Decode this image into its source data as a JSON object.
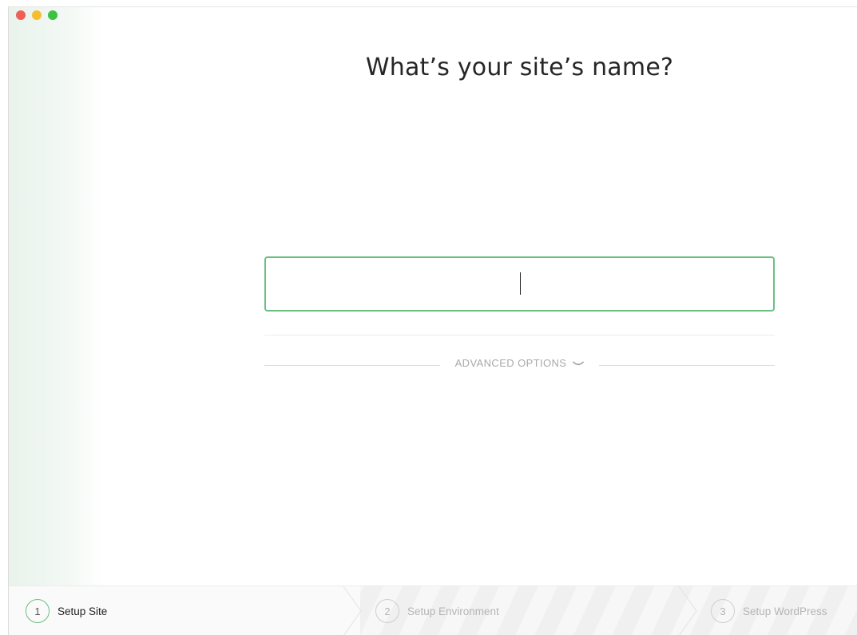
{
  "window": {
    "controls": [
      "close",
      "minimize",
      "maximize"
    ]
  },
  "main": {
    "title": "What’s your site’s name?",
    "site_name_input": {
      "value": "",
      "placeholder": ""
    },
    "advanced_options_label": "ADVANCED OPTIONS",
    "advanced_options_icon": "chevron-down-icon"
  },
  "footer": {
    "steps": [
      {
        "number": "1",
        "label": "Setup Site",
        "state": "active"
      },
      {
        "number": "2",
        "label": "Setup Environment",
        "state": "inactive"
      },
      {
        "number": "3",
        "label": "Setup WordPress",
        "state": "inactive"
      }
    ]
  },
  "colors": {
    "accent": "#6bbf82",
    "close": "#ee5f56",
    "minimize": "#f6bd2e",
    "maximize": "#3dc140",
    "muted_text": "#a9a9a9"
  }
}
